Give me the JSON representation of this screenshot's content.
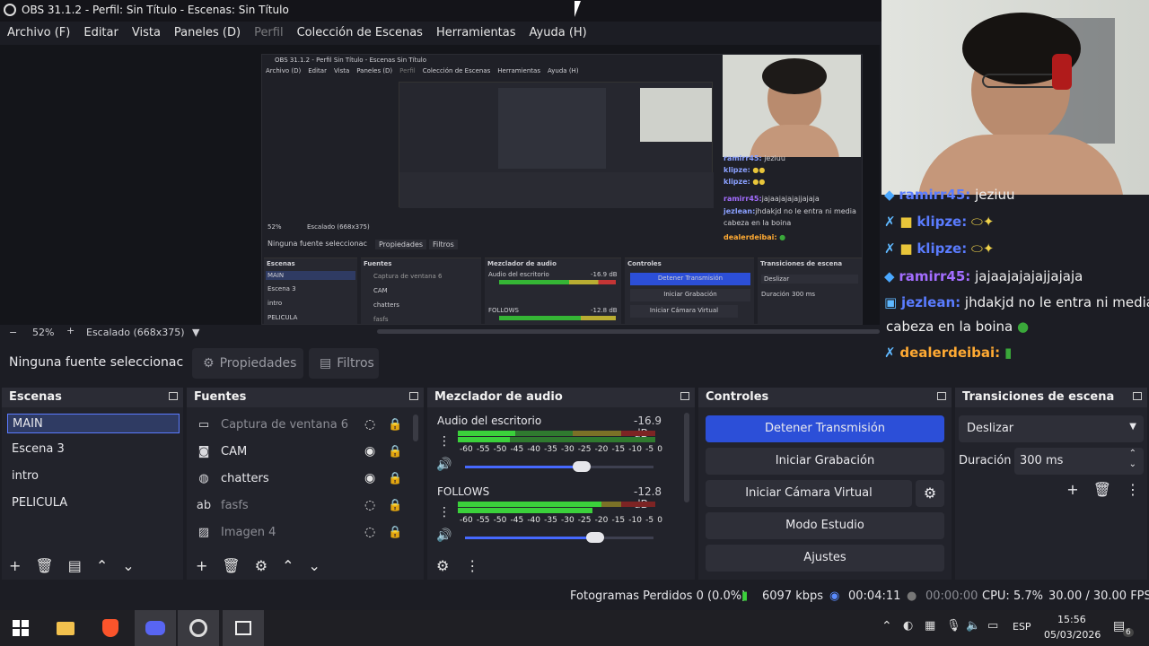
{
  "window": {
    "title": "OBS 31.1.2 - Perfil: Sin Título - Escenas: Sin Título"
  },
  "menu": [
    "Archivo (F)",
    "Editar",
    "Vista",
    "Paneles (D)",
    "Perfil",
    "Colección de Escenas",
    "Herramientas",
    "Ayuda (H)"
  ],
  "nested_preview": {
    "title": "OBS 31.1.2 - Perfil Sin Título - Escenas Sin Título",
    "menu": [
      "Archivo (D)",
      "Editar",
      "Vista",
      "Paneles (D)",
      "Perfil",
      "Colección de Escenas",
      "Herramientas",
      "Ayuda (H)"
    ],
    "zoom": "52%",
    "scale": "Escalado (668x375)",
    "no_source": "Ninguna fuente seleccionac",
    "properties": "Propiedades",
    "filters": "Filtros",
    "scenes_title": "Escenas",
    "scenes": [
      "MAIN",
      "Escena 3",
      "intro",
      "PELICULA"
    ],
    "sources_title": "Fuentes",
    "sources": [
      "Captura de ventana 6",
      "CAM",
      "chatters",
      "fasfs"
    ],
    "mixer_title": "Mezclador de audio",
    "mixer_ch1": "Audio del escritorio",
    "mixer_ch1_db": "-16.9 dB",
    "mixer_ch2": "FOLLOWS",
    "mixer_ch2_db": "-12.8 dB",
    "controls_title": "Controles",
    "ctrl1": "Detener Transmisión",
    "ctrl2": "Iniciar Grabación",
    "ctrl3": "Iniciar Cámara Virtual",
    "trans_title": "Transiciones de escena",
    "trans_value": "Deslizar",
    "duration_label": "Duración",
    "duration_value": "300 ms"
  },
  "small_chat": [
    {
      "name": "ramirr45:",
      "text": "jeziuu"
    },
    {
      "name": "klipze:",
      "text": ""
    },
    {
      "name": "klipze:",
      "text": ""
    },
    {
      "name": "ramirr45:",
      "text": "jajaajajajajjajaja"
    },
    {
      "name": "jezlean:",
      "text": "jhdakjd no le entra ni media"
    },
    {
      "name": "",
      "text": "cabeza en la boina"
    },
    {
      "name": "dealerdeibai:",
      "text": ""
    }
  ],
  "chat": [
    {
      "icon": "cube",
      "name": "ramirr45:",
      "text": "jeziuu",
      "color": "#5a7cff"
    },
    {
      "icon": "sword",
      "name": "klipze:",
      "text": "",
      "color": "#5a7cff"
    },
    {
      "icon": "sword",
      "name": "klipze:",
      "text": "",
      "color": "#5a7cff"
    },
    {
      "icon": "cube",
      "name": "ramirr45:",
      "text": "jajaajajajajjajaja",
      "color": "#a36dff"
    },
    {
      "icon": "badge",
      "name": "jezlean:",
      "text": "jhdakjd no le entra ni media",
      "color": "#5a7cff"
    },
    {
      "icon": "",
      "name": "",
      "text": "cabeza en la boina",
      "color": "#ffffff"
    },
    {
      "icon": "sword",
      "name": "dealerdeibai:",
      "text": "",
      "color": "#ffaa33"
    }
  ],
  "preview": {
    "zoom": "52%",
    "scale": "Escalado (668x375)"
  },
  "source_bar": {
    "no_source": "Ninguna fuente seleccionac",
    "properties": "Propiedades",
    "filters": "Filtros"
  },
  "scenes": {
    "title": "Escenas",
    "items": [
      "MAIN",
      "Escena 3",
      "intro",
      "PELICULA"
    ]
  },
  "sources": {
    "title": "Fuentes",
    "items": [
      {
        "label": "Captura de ventana 6",
        "icon": "window-icon",
        "visible": false
      },
      {
        "label": "CAM",
        "icon": "camera-icon",
        "visible": true
      },
      {
        "label": "chatters",
        "icon": "globe-icon",
        "visible": true
      },
      {
        "label": "fasfs",
        "icon": "text-icon",
        "visible": false
      },
      {
        "label": "Imagen 4",
        "icon": "image-icon",
        "visible": false
      }
    ]
  },
  "mixer": {
    "title": "Mezclador de audio",
    "channels": [
      {
        "name": "Audio del escritorio",
        "db": "-16.9 dB",
        "volume": 0.62
      },
      {
        "name": "FOLLOWS",
        "db": "-12.8 dB",
        "volume": 0.69
      }
    ],
    "ticks": [
      "-60",
      "-55",
      "-50",
      "-45",
      "-40",
      "-35",
      "-30",
      "-25",
      "-20",
      "-15",
      "-10",
      "-5",
      "0"
    ]
  },
  "controls": {
    "title": "Controles",
    "stop_stream": "Detener Transmisión",
    "start_record": "Iniciar Grabación",
    "start_vcam": "Iniciar Cámara Virtual",
    "studio_mode": "Modo Estudio",
    "settings": "Ajustes"
  },
  "transitions": {
    "title": "Transiciones de escena",
    "value": "Deslizar",
    "duration_label": "Duración",
    "duration_value": "300 ms"
  },
  "status": {
    "dropped": "Fotogramas Perdidos 0 (0.0%)",
    "bitrate": "6097 kbps",
    "stream_time": "00:04:11",
    "record_time": "00:00:00",
    "cpu": "CPU: 5.7%",
    "fps": "30.00 / 30.00 FPS"
  },
  "taskbar": {
    "lang": "ESP",
    "time": "15:56",
    "date": "05/03/2026",
    "notif_count": "6"
  },
  "colors": {
    "accent": "#2c4fd8",
    "selected": "#2f3b63",
    "meter_green": "#3bd13b",
    "meter_yellow": "#c4b836",
    "meter_red": "#d23a3a"
  }
}
